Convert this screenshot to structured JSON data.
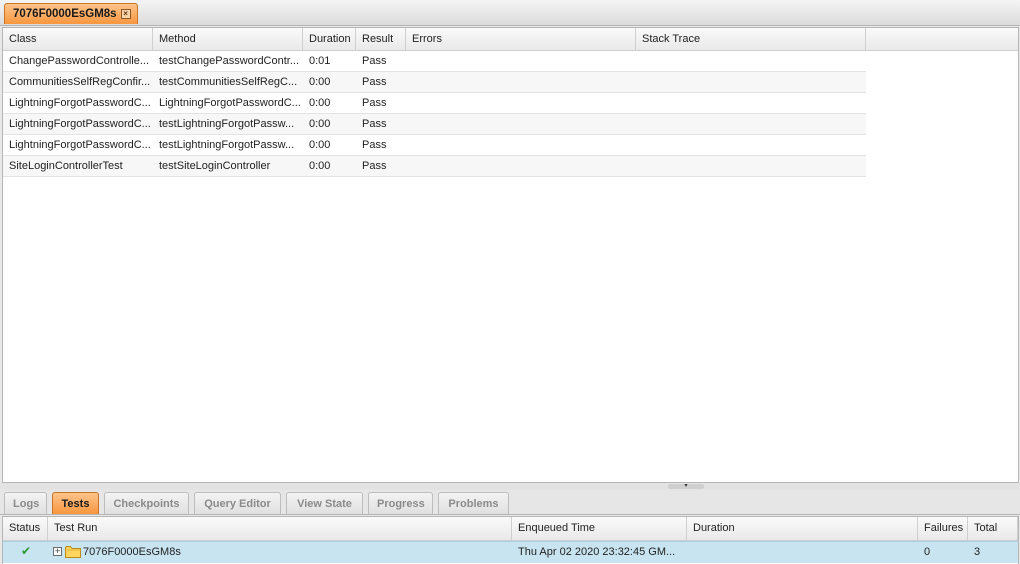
{
  "editor_tab": {
    "label": "7076F0000EsGM8s",
    "close_glyph": "×"
  },
  "results": {
    "columns": [
      "Class",
      "Method",
      "Duration",
      "Result",
      "Errors",
      "Stack Trace"
    ],
    "rows": [
      {
        "class": "ChangePasswordControlle...",
        "method": "testChangePasswordContr...",
        "duration": "0:01",
        "result": "Pass",
        "errors": "",
        "stack": ""
      },
      {
        "class": "CommunitiesSelfRegConfir...",
        "method": "testCommunitiesSelfRegC...",
        "duration": "0:00",
        "result": "Pass",
        "errors": "",
        "stack": ""
      },
      {
        "class": "LightningForgotPasswordC...",
        "method": "LightningForgotPasswordC...",
        "duration": "0:00",
        "result": "Pass",
        "errors": "",
        "stack": ""
      },
      {
        "class": "LightningForgotPasswordC...",
        "method": "testLightningForgotPassw...",
        "duration": "0:00",
        "result": "Pass",
        "errors": "",
        "stack": ""
      },
      {
        "class": "LightningForgotPasswordC...",
        "method": "testLightningForgotPassw...",
        "duration": "0:00",
        "result": "Pass",
        "errors": "",
        "stack": ""
      },
      {
        "class": "SiteLoginControllerTest",
        "method": "testSiteLoginController",
        "duration": "0:00",
        "result": "Pass",
        "errors": "",
        "stack": ""
      }
    ]
  },
  "splitter": {
    "icon": "collapse-arrow-icon",
    "glyph": "▾"
  },
  "bottom_tabs": [
    {
      "label": "Logs",
      "active": false
    },
    {
      "label": "Tests",
      "active": true
    },
    {
      "label": "Checkpoints",
      "active": false
    },
    {
      "label": "Query Editor",
      "active": false
    },
    {
      "label": "View State",
      "active": false
    },
    {
      "label": "Progress",
      "active": false
    },
    {
      "label": "Problems",
      "active": false
    }
  ],
  "runs": {
    "columns": [
      "Status",
      "Test Run",
      "Enqueued Time",
      "Duration",
      "Failures",
      "Total"
    ],
    "rows": [
      {
        "status_icon": "checkmark-icon",
        "status_glyph": "✔",
        "expand_glyph": "+",
        "test_run": "7076F0000EsGM8s",
        "enqueued": "Thu Apr 02 2020 23:32:45 GM...",
        "duration": "",
        "failures": "0",
        "total": "3"
      }
    ]
  },
  "colors": {
    "accent_tab": "#f7963e",
    "selected_row": "#c8e4f0",
    "pass_check": "#2a9a2a"
  }
}
